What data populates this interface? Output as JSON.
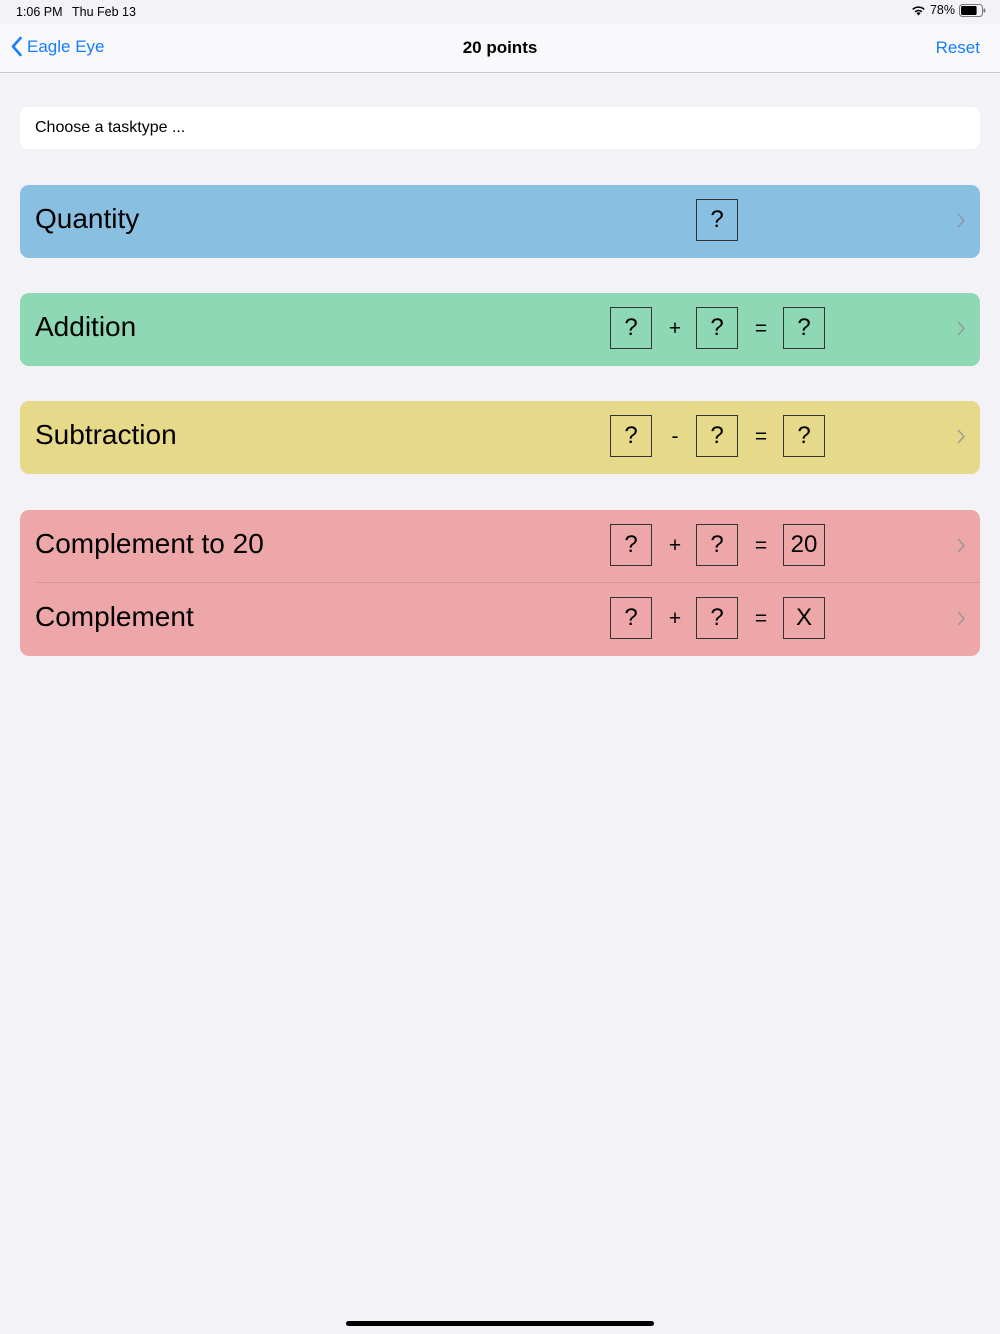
{
  "status_bar": {
    "time": "1:06 PM",
    "date": "Thu Feb 13",
    "battery": "78%",
    "battery_level": 0.78
  },
  "nav": {
    "back_label": "Eagle Eye",
    "title": "20 points",
    "reset_label": "Reset"
  },
  "hint": "Choose a tasktype ...",
  "colors": {
    "quantity": "#89c0e2",
    "addition": "#8fd8b5",
    "subtraction": "#e6da8a",
    "complement": "#eea7a8",
    "accent": "#147efb"
  },
  "tasks": {
    "quantity": {
      "label": "Quantity",
      "box1": "?"
    },
    "addition": {
      "label": "Addition",
      "box1": "?",
      "op": "+",
      "box2": "?",
      "eq": "=",
      "box3": "?"
    },
    "subtraction": {
      "label": "Subtraction",
      "box1": "?",
      "op": "-",
      "box2": "?",
      "eq": "=",
      "box3": "?"
    },
    "complement_to_20": {
      "label": "Complement to 20",
      "box1": "?",
      "op": "+",
      "box2": "?",
      "eq": "=",
      "box3": "20"
    },
    "complement": {
      "label": "Complement",
      "box1": "?",
      "op": "+",
      "box2": "?",
      "eq": "=",
      "box3": "X"
    }
  }
}
